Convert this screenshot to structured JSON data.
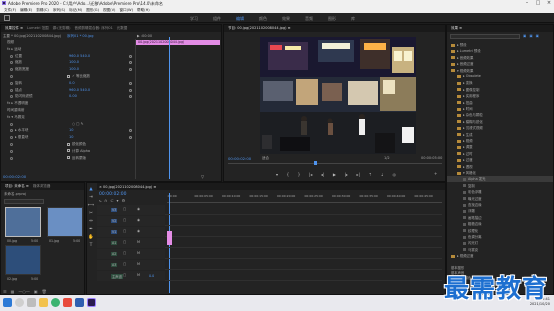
{
  "window": {
    "title": "Adobe Premiere Pro 2020 - C:\\用户\\Ado...\\迁移\\Adobe\\Premiere Pro\\14.0\\未命名"
  },
  "menu": [
    "文件(F)",
    "编辑(E)",
    "剪辑(C)",
    "序列(S)",
    "标记(M)",
    "图形(G)",
    "视图(V)",
    "窗口(W)",
    "帮助(H)"
  ],
  "workspaces": [
    {
      "label": "学习",
      "active": false
    },
    {
      "label": "组件",
      "active": false
    },
    {
      "label": "编辑",
      "active": true
    },
    {
      "label": "颜色",
      "active": false
    },
    {
      "label": "效果",
      "active": false
    },
    {
      "label": "音频",
      "active": false
    },
    {
      "label": "图形",
      "active": false
    },
    {
      "label": "库",
      "active": false
    }
  ],
  "effect_controls": {
    "tabs": [
      "效果控件 ≡",
      "Lumetri 范围",
      "源:(无剪辑)",
      "音频剪辑混合器: 序列01",
      "元数据"
    ],
    "source_label": "主要 * 00.jpg(202110200844.jpg)",
    "sequence_label": "序列01 * 00.jpg",
    "clip_name": "00.jpg(2021102008044.jpg)",
    "time_ruler": "▶ :00:00",
    "rows": [
      {
        "label": "视频",
        "value": "",
        "hdr": true
      },
      {
        "label": "fx ▸ 运动",
        "value": "",
        "hdr": true
      },
      {
        "label": "位置",
        "value": "960.0   540.0"
      },
      {
        "label": "缩放",
        "value": "100.0"
      },
      {
        "label": "缩放宽度",
        "value": "100.0"
      },
      {
        "label": "",
        "value": "✓ 等比缩放",
        "check": true
      },
      {
        "label": "旋转",
        "value": "0.0"
      },
      {
        "label": "锚点",
        "value": "960.0   540.0"
      },
      {
        "label": "防闪烁滤镜",
        "value": "0.00"
      },
      {
        "label": "fx ▸ 不透明度",
        "value": "",
        "hdr": true
      },
      {
        "label": "时间重映射",
        "value": "",
        "hdr": true
      },
      {
        "label": "fx ▾ 马赛克",
        "value": "",
        "hdr": true
      },
      {
        "label": "",
        "value": "○ □ ✎",
        "icons": true
      },
      {
        "label": "▸ 水平块",
        "value": "10"
      },
      {
        "label": "▸ 垂直块",
        "value": "10"
      },
      {
        "label": "",
        "value": "锐化颜色",
        "check": true
      },
      {
        "label": "",
        "value": "计算 Alpha",
        "check": true
      },
      {
        "label": "",
        "value": "反转蒙版",
        "check": true
      }
    ],
    "footer_time": "00:00:02:00"
  },
  "program_monitor": {
    "tab": "节目: 00.jpg(2021102008044.jpg) ≡",
    "timecode_in": "00:00:02:00",
    "fit": "适合",
    "scale": "1/2",
    "timecode_out": "00:00:05:00"
  },
  "project": {
    "tabs": [
      "项目: 未命名 ≡",
      "媒体浏览器"
    ],
    "path": "未命名.prproj",
    "items": [
      {
        "name": "00.jpg",
        "duration": "5:00",
        "color": "#4f6f9a"
      },
      {
        "name": "01.jpg",
        "duration": "5:00",
        "color": "#6a8fc3"
      },
      {
        "name": "02.jpg",
        "duration": "5:00",
        "color": "#2d4e7a"
      }
    ]
  },
  "timeline": {
    "tab": "× 00.jpg(2021102008044.jpg) ≡",
    "timecode": "00:00:02:00",
    "ruler": [
      ":00:00",
      "00:00:05:00",
      "00:00:10:00",
      "00:00:15:00",
      "00:00:20:00",
      "00:00:25:00",
      "00:00:30:00",
      "00:00:35:00",
      "00:00:40:00",
      "00:00:45:00"
    ],
    "tracks": [
      "V3",
      "V2",
      "V1",
      "A1",
      "A2",
      "A3",
      "主声道"
    ],
    "master_value": "0.0"
  },
  "effects_panel": {
    "tab": "效果 ≡",
    "tree": [
      {
        "label": "▸ 预设",
        "indent": 0
      },
      {
        "label": "▸ Lumetri 预设",
        "indent": 0
      },
      {
        "label": "▸ 音频效果",
        "indent": 0
      },
      {
        "label": "▸ 音频过渡",
        "indent": 0
      },
      {
        "label": "▾ 视频效果",
        "indent": 0
      },
      {
        "label": "▸ Obsolete",
        "indent": 1
      },
      {
        "label": "▸ 变换",
        "indent": 1
      },
      {
        "label": "▸ 图像控制",
        "indent": 1
      },
      {
        "label": "▸ 实用程序",
        "indent": 1
      },
      {
        "label": "▸ 扭曲",
        "indent": 1
      },
      {
        "label": "▸ 时间",
        "indent": 1
      },
      {
        "label": "▸ 杂色与颗粒",
        "indent": 1
      },
      {
        "label": "▸ 模糊与锐化",
        "indent": 1
      },
      {
        "label": "▸ 沉浸式视频",
        "indent": 1
      },
      {
        "label": "▸ 生成",
        "indent": 1
      },
      {
        "label": "▸ 视频",
        "indent": 1
      },
      {
        "label": "▸ 调整",
        "indent": 1
      },
      {
        "label": "▸ 过时",
        "indent": 1
      },
      {
        "label": "▸ 过渡",
        "indent": 1
      },
      {
        "label": "▸ 透视",
        "indent": 1
      },
      {
        "label": "▾ 风格化",
        "indent": 1
      },
      {
        "label": "Alpha 发光",
        "indent": 2,
        "sel": true
      },
      {
        "label": "复制",
        "indent": 2
      },
      {
        "label": "彩色浮雕",
        "indent": 2
      },
      {
        "label": "曝光过度",
        "indent": 2
      },
      {
        "label": "查找边缘",
        "indent": 2
      },
      {
        "label": "浮雕",
        "indent": 2
      },
      {
        "label": "画笔描边",
        "indent": 2
      },
      {
        "label": "粗糙边缘",
        "indent": 2
      },
      {
        "label": "纹理化",
        "indent": 2
      },
      {
        "label": "色调分离",
        "indent": 2
      },
      {
        "label": "闪光灯",
        "indent": 2
      },
      {
        "label": "马赛克",
        "indent": 2
      },
      {
        "label": "▸ 视频过渡",
        "indent": 0
      }
    ],
    "bottom": [
      "基本图形",
      "基本声音",
      "Lumetri 颜色",
      "库",
      "标记",
      "历史记录"
    ]
  },
  "taskbar": {
    "time": "15:41",
    "date": "2021/10/20"
  },
  "watermark": "最需教育",
  "colors": {
    "accent": "#4f94ee",
    "clip": "#e38ce5",
    "clip_audio": "#5b9e6b"
  }
}
